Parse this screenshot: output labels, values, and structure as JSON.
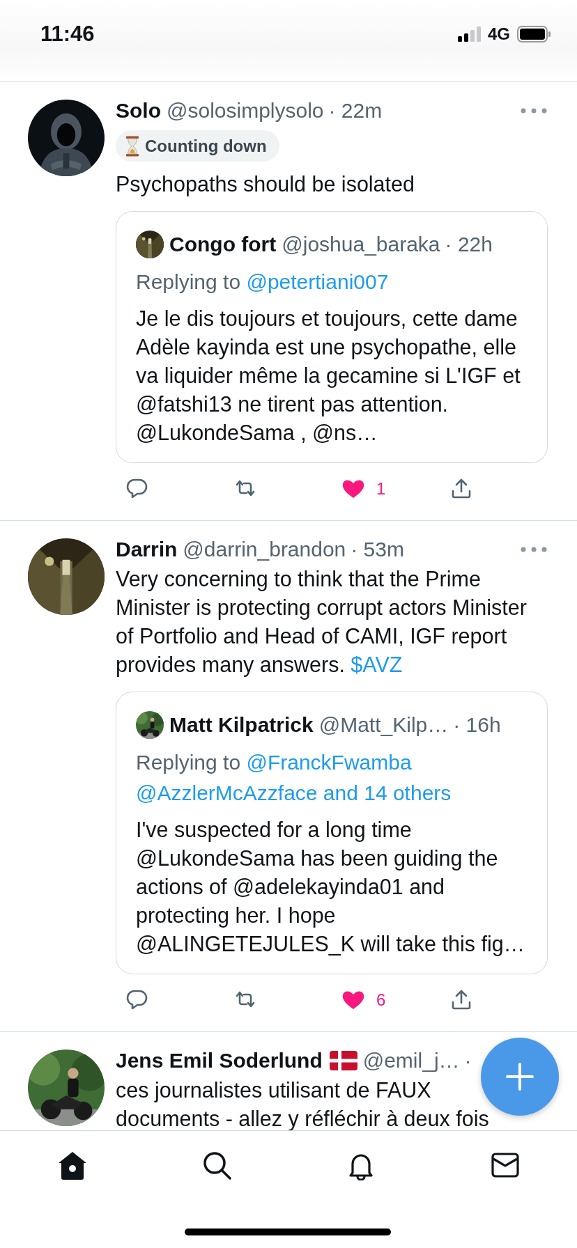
{
  "status_bar": {
    "time": "11:46",
    "network": "4G"
  },
  "tweets": [
    {
      "name": "Solo",
      "handle": "@solosimplysolo",
      "time": "· 22m",
      "flag": false,
      "badge": {
        "label": "Counting down"
      },
      "text": [
        {
          "text": "Psychopaths should be isolated",
          "link": false
        }
      ],
      "quote": {
        "name": "Congo fort",
        "handle": "@joshua_baraka",
        "time": "· 22h",
        "reply_label": "Replying to",
        "reply_targets": [
          "@petertiani007"
        ],
        "text": "Je le dis toujours et toujours, cette dame Adèle kayinda est une psychopathe, elle va liquider même la gecamine si L'IGF et @fatshi13 ne tirent pas attention. @LukondeSama , @ns…"
      },
      "likes": "1",
      "liked": true
    },
    {
      "name": "Darrin",
      "handle": "@darrin_brandon",
      "time": "· 53m",
      "flag": false,
      "text": [
        {
          "text": "Very concerning to think that the Prime Minister is protecting corrupt actors Minister of Portfolio and Head of CAMI, IGF report provides many answers. ",
          "link": false
        },
        {
          "text": "$AVZ",
          "link": true
        }
      ],
      "quote": {
        "name": "Matt Kilpatrick",
        "handle": "@Matt_Kilp…",
        "time": "· 16h",
        "reply_label": "Replying to",
        "reply_targets": [
          "@FranckFwamba",
          "@AzzlerMcAzzface and 14 others"
        ],
        "text": "I've suspected for a long time @LukondeSama has been  guiding the actions of @adelekayinda01 and protecting her. I hope @ALINGETEJULES_K will take this fig…"
      },
      "likes": "6",
      "liked": true
    },
    {
      "name": "Jens Emil Soderlund",
      "handle": "@emil_j…",
      "time": "·",
      "flag": true,
      "text": [
        {
          "text": "ces journalistes utilisant de FAUX documents - allez y réfléchir à deux fois",
          "link": false
        }
      ]
    }
  ],
  "tabs": [
    {
      "kind": "home",
      "selected": true
    },
    {
      "kind": "search",
      "selected": false
    },
    {
      "kind": "notifications",
      "selected": false
    },
    {
      "kind": "messages",
      "selected": false
    }
  ]
}
